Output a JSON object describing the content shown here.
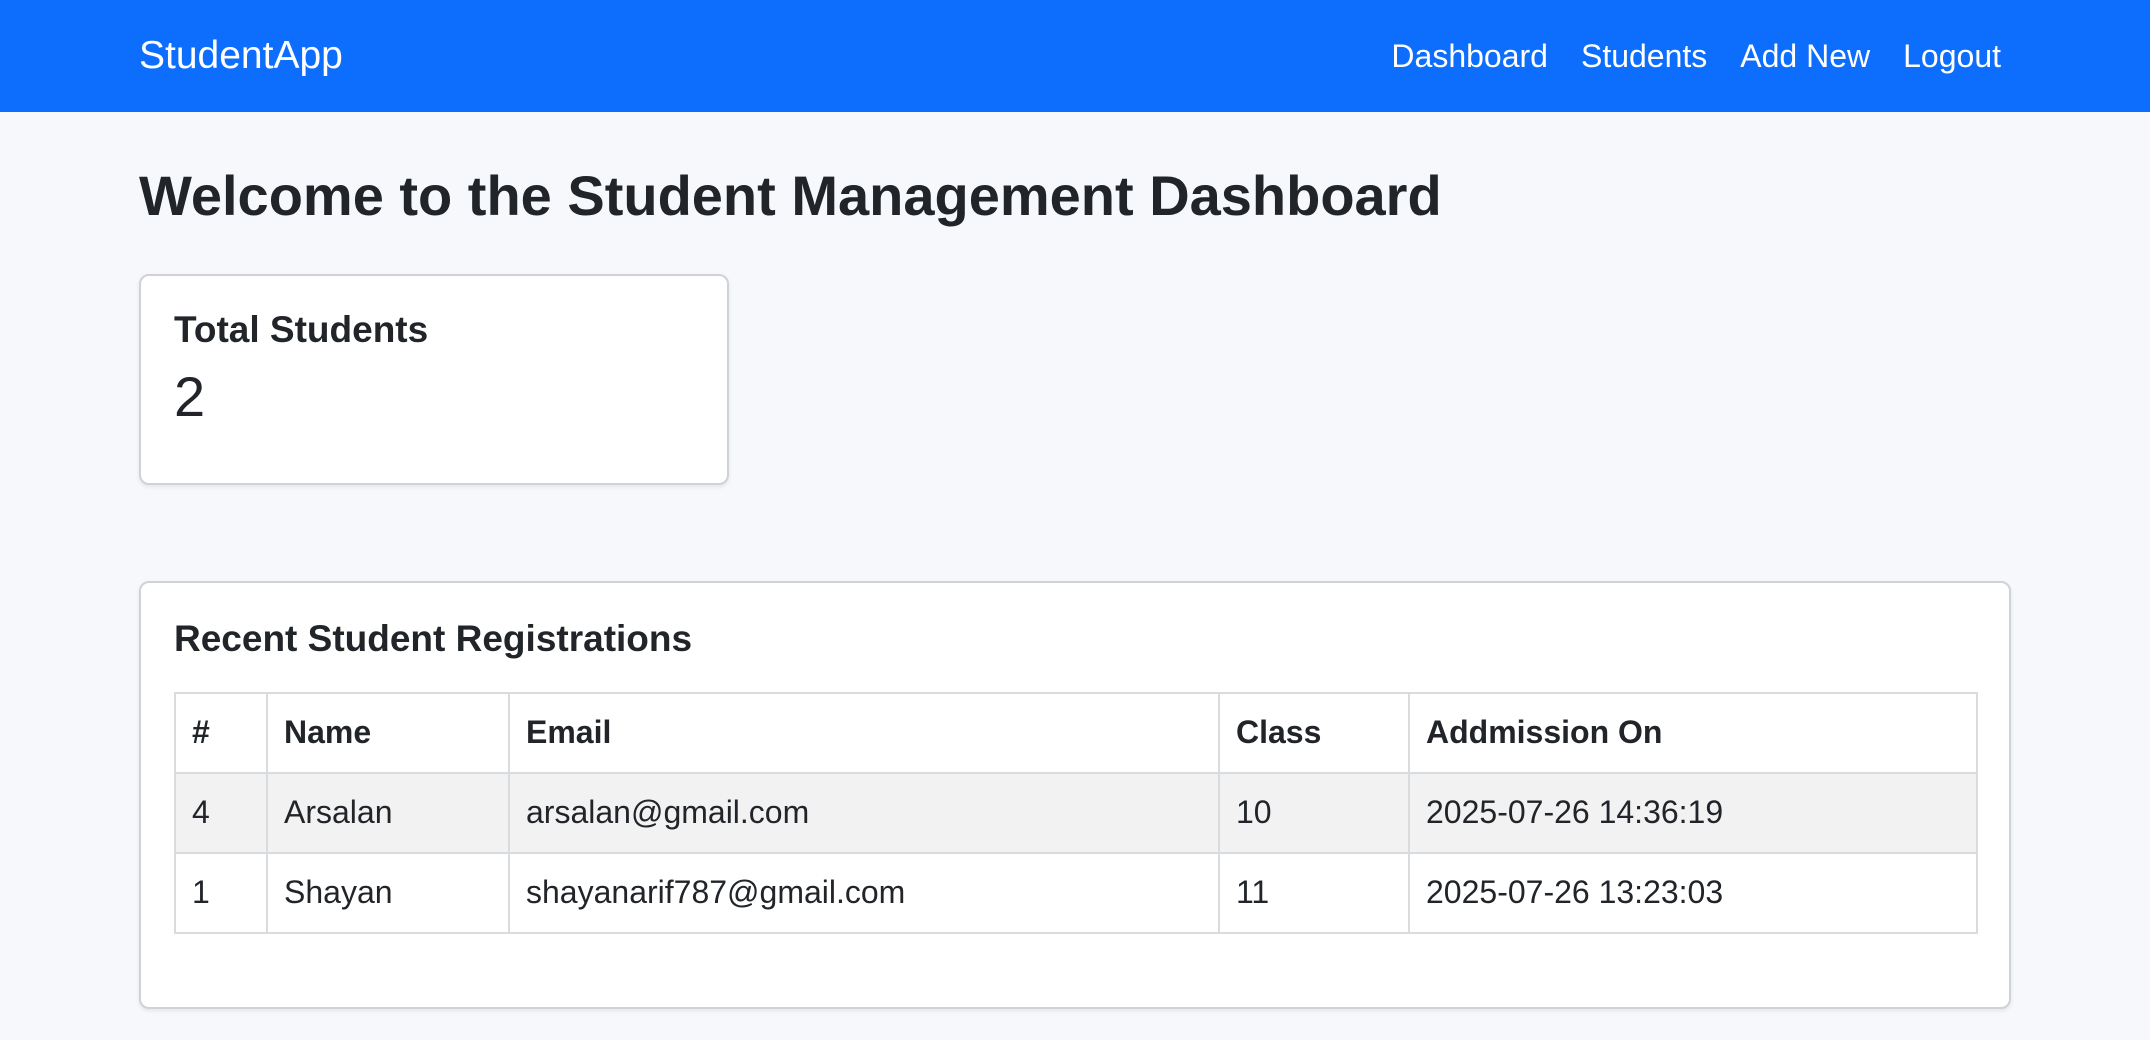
{
  "nav": {
    "brand": "StudentApp",
    "links": [
      "Dashboard",
      "Students",
      "Add New",
      "Logout"
    ]
  },
  "page": {
    "title": "Welcome to the Student Management Dashboard"
  },
  "stats": {
    "total_label": "Total Students",
    "total_value": "2"
  },
  "recent": {
    "title": "Recent Student Registrations",
    "columns": [
      "#",
      "Name",
      "Email",
      "Class",
      "Addmission On"
    ],
    "rows": [
      [
        "4",
        "Arsalan",
        "arsalan@gmail.com",
        "10",
        "2025-07-26 14:36:19"
      ],
      [
        "1",
        "Shayan",
        "shayanarif787@gmail.com",
        "11",
        "2025-07-26 13:23:03"
      ]
    ]
  },
  "colors": {
    "navbar": "#0d6efd",
    "background": "#f7f8fb",
    "row_stripe": "#f2f2f2"
  }
}
